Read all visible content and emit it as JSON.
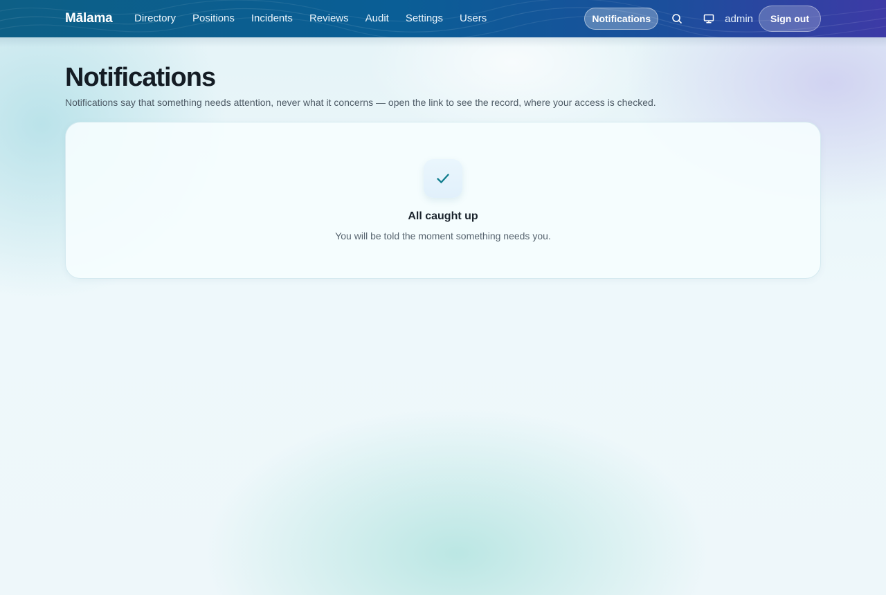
{
  "brand": "Mālama",
  "nav": {
    "items": [
      {
        "label": "Directory"
      },
      {
        "label": "Positions"
      },
      {
        "label": "Incidents"
      },
      {
        "label": "Reviews"
      },
      {
        "label": "Audit"
      },
      {
        "label": "Settings"
      },
      {
        "label": "Users"
      }
    ]
  },
  "header": {
    "notifications_label": "Notifications",
    "search_icon": "search-icon",
    "display_icon": "monitor-icon",
    "username": "admin",
    "sign_out_label": "Sign out"
  },
  "page": {
    "title": "Notifications",
    "subtitle": "Notifications say that something needs attention, never what it concerns — open the link to see the record, where your access is checked."
  },
  "empty_state": {
    "icon": "check-icon",
    "title": "All caught up",
    "text": "You will be told the moment something needs you."
  },
  "colors": {
    "header_start": "#0d5f86",
    "header_end": "#3d3aa6",
    "accent": "#0e7c8c"
  }
}
